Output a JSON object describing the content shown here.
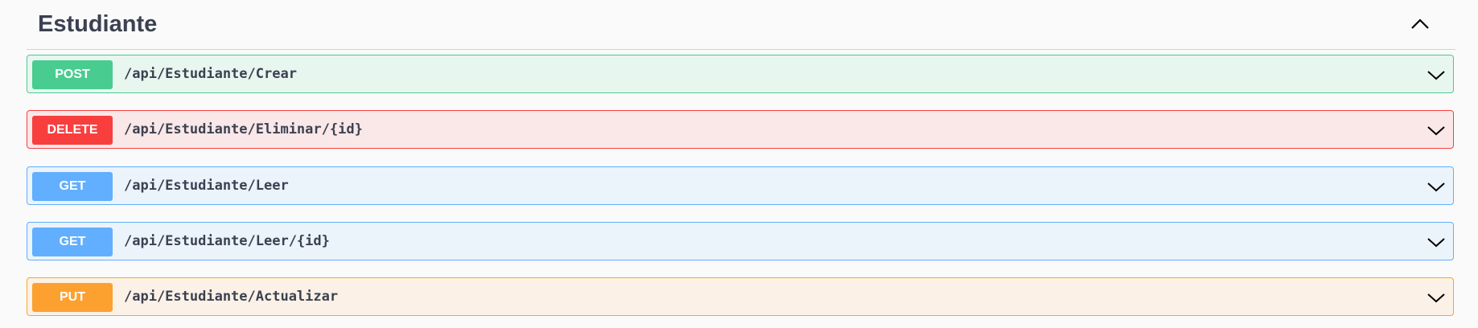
{
  "section": {
    "title": "Estudiante",
    "toggle_icon": "chevron-up-icon"
  },
  "operations": [
    {
      "method": "POST",
      "path": "/api/Estudiante/Crear",
      "color": "#49cc90",
      "bg": "#e8f6f0",
      "border": "#49cc90"
    },
    {
      "method": "DELETE",
      "path": "/api/Estudiante/Eliminar/{id}",
      "color": "#f93e3e",
      "bg": "#fae7e7",
      "border": "#f93e3e"
    },
    {
      "method": "GET",
      "path": "/api/Estudiante/Leer",
      "color": "#61affe",
      "bg": "#ebf3fb",
      "border": "#61affe"
    },
    {
      "method": "GET",
      "path": "/api/Estudiante/Leer/{id}",
      "color": "#61affe",
      "bg": "#ebf3fb",
      "border": "#61affe"
    },
    {
      "method": "PUT",
      "path": "/api/Estudiante/Actualizar",
      "color": "#fca130",
      "bg": "#fbf1e6",
      "border": "#fca130"
    }
  ]
}
